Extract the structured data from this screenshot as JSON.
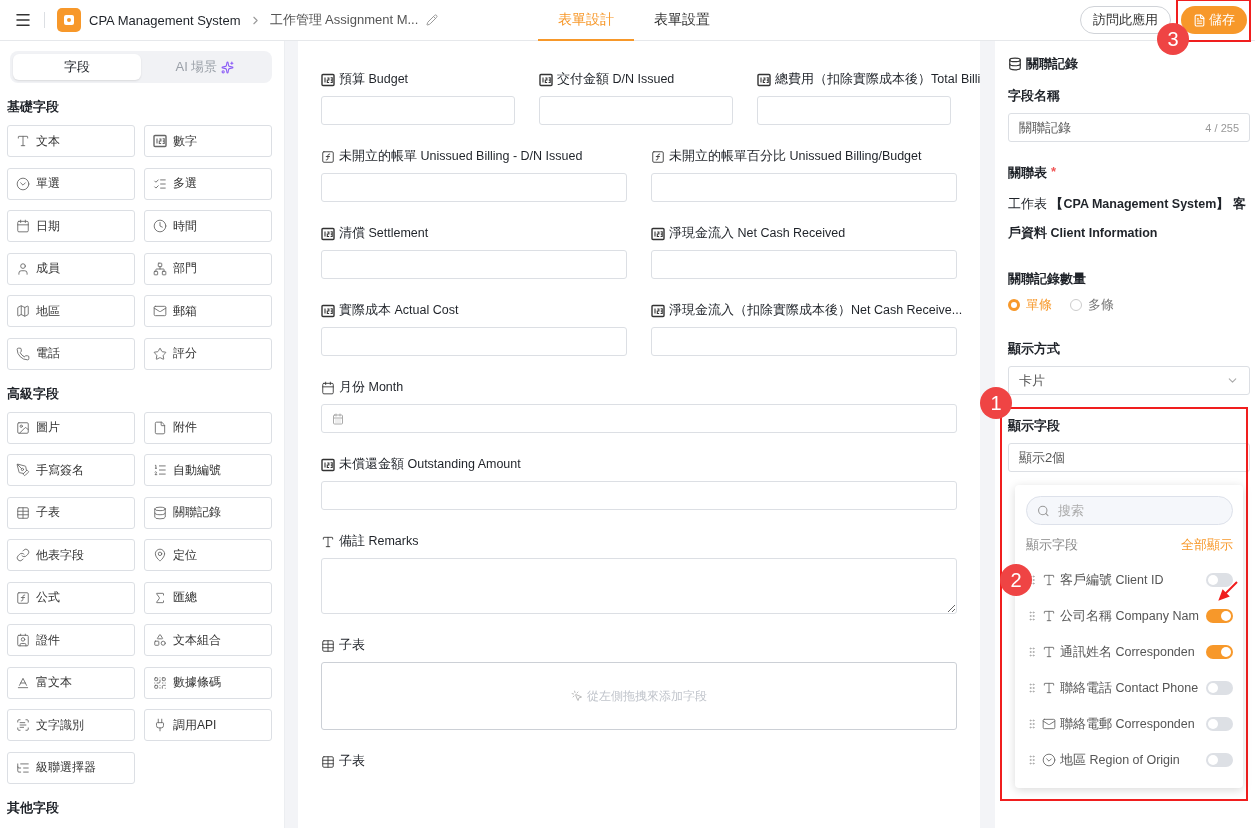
{
  "topbar": {
    "app_name": "CPA Management System",
    "page_name": "工作管理 Assignment M...",
    "tabs": [
      {
        "label": "表單設計",
        "selected": true
      },
      {
        "label": "表單設置",
        "selected": false
      }
    ],
    "visit_button": "訪問此應用",
    "save_button": {
      "label": "儲存",
      "annotation": "3"
    }
  },
  "palette": {
    "tabs": [
      {
        "label": "字段",
        "selected": true,
        "kind": "fields"
      },
      {
        "label": "AI 場景",
        "selected": false,
        "kind": "ai"
      }
    ],
    "sections": [
      {
        "title": "基礎字段",
        "items": [
          {
            "kind": "text",
            "label": "文本"
          },
          {
            "kind": "number",
            "label": "數字"
          },
          {
            "kind": "radio",
            "label": "單選"
          },
          {
            "kind": "checklist",
            "label": "多選"
          },
          {
            "kind": "date",
            "label": "日期"
          },
          {
            "kind": "time",
            "label": "時間"
          },
          {
            "kind": "member",
            "label": "成員"
          },
          {
            "kind": "dept",
            "label": "部門"
          },
          {
            "kind": "region",
            "label": "地區"
          },
          {
            "kind": "email",
            "label": "郵箱"
          },
          {
            "kind": "phone",
            "label": "電話"
          },
          {
            "kind": "rating",
            "label": "評分"
          }
        ]
      },
      {
        "title": "高級字段",
        "items": [
          {
            "kind": "image",
            "label": "圖片"
          },
          {
            "kind": "file",
            "label": "附件"
          },
          {
            "kind": "signature",
            "label": "手寫簽名"
          },
          {
            "kind": "autonumber",
            "label": "自動編號"
          },
          {
            "kind": "subtable",
            "label": "子表"
          },
          {
            "kind": "relation",
            "label": "關聯記錄"
          },
          {
            "kind": "link",
            "label": "他表字段"
          },
          {
            "kind": "location",
            "label": "定位"
          },
          {
            "kind": "formula",
            "label": "公式"
          },
          {
            "kind": "sum",
            "label": "匯總"
          },
          {
            "kind": "idcard",
            "label": "證件"
          },
          {
            "kind": "combo",
            "label": "文本組合"
          },
          {
            "kind": "richtext",
            "label": "富文本"
          },
          {
            "kind": "barcode",
            "label": "數據條碼"
          },
          {
            "kind": "ocr",
            "label": "文字識別"
          },
          {
            "kind": "api",
            "label": "調用API"
          },
          {
            "kind": "cascade",
            "label": "級聯選擇器"
          }
        ]
      },
      {
        "title": "其他字段"
      }
    ]
  },
  "form": {
    "rows": [
      {
        "fields": [
          {
            "kind": "number",
            "label": "預算 Budget"
          },
          {
            "kind": "number",
            "label": "交付金額 D/N Issued"
          },
          {
            "kind": "number",
            "label": "總費用（扣除實際成本後）Total Billi"
          }
        ]
      },
      {
        "fields": [
          {
            "kind": "formula",
            "label": "未開立的帳單 Unissued Billing - D/N Issued"
          },
          {
            "kind": "formula",
            "label": "未開立的帳單百分比 Unissued Billing/Budget"
          }
        ]
      },
      {
        "fields": [
          {
            "kind": "number",
            "label": "清償 Settlement"
          },
          {
            "kind": "number",
            "label": "淨現金流入 Net Cash Received"
          }
        ]
      },
      {
        "fields": [
          {
            "kind": "number",
            "label": "實際成本 Actual Cost"
          },
          {
            "kind": "number",
            "label": "淨現金流入（扣除實際成本後）Net Cash Receive..."
          }
        ]
      },
      {
        "fields": [
          {
            "kind": "date",
            "label": "月份 Month"
          }
        ]
      },
      {
        "fields": [
          {
            "kind": "number",
            "label": "未償還金額 Outstanding Amount"
          }
        ]
      },
      {
        "fields": [
          {
            "kind": "text",
            "label": "備註 Remarks"
          }
        ]
      },
      {
        "fields": [
          {
            "kind": "subtable",
            "label": "子表",
            "hint": "從左側拖拽來添加字段"
          }
        ]
      },
      {
        "fields": [
          {
            "kind": "subtable",
            "label": "子表"
          }
        ]
      }
    ]
  },
  "properties": {
    "title": "關聯記錄",
    "field_name": {
      "label": "字段名稱",
      "value": "關聯記錄",
      "counter": "4 / 255"
    },
    "related_table": {
      "label": "關聯表",
      "required_mark": "*",
      "value": "工作表 **【CPA Management System】 客戶資料 Client Information**"
    },
    "count": {
      "label": "關聯記錄數量",
      "options": [
        {
          "label": "單條",
          "selected": true
        },
        {
          "label": "多條",
          "selected": false
        }
      ]
    },
    "display_mode": {
      "label": "顯示方式",
      "value": "卡片"
    },
    "display_fields": {
      "label": "顯示字段",
      "value": "顯示2個",
      "annotation": "1",
      "popover": {
        "search_placeholder": "搜索",
        "header": "顯示字段",
        "show_all": "全部顯示",
        "items": [
          {
            "kind": "text",
            "label": "客戶編號 Client ID",
            "on": false,
            "annotation": "2",
            "pointer": false
          },
          {
            "kind": "text",
            "label": "公司名稱 Company Nam",
            "on": true,
            "pointer": true
          },
          {
            "kind": "text",
            "label": "通訊姓名 Corresponden",
            "on": true,
            "pointer": false
          },
          {
            "kind": "text",
            "label": "聯絡電話 Contact Phone",
            "on": false,
            "pointer": false
          },
          {
            "kind": "email",
            "label": "聯絡電郵 Corresponden",
            "on": false,
            "pointer": false
          },
          {
            "kind": "radio",
            "label": "地區 Region of Origin",
            "on": false,
            "pointer": false
          }
        ]
      }
    }
  }
}
